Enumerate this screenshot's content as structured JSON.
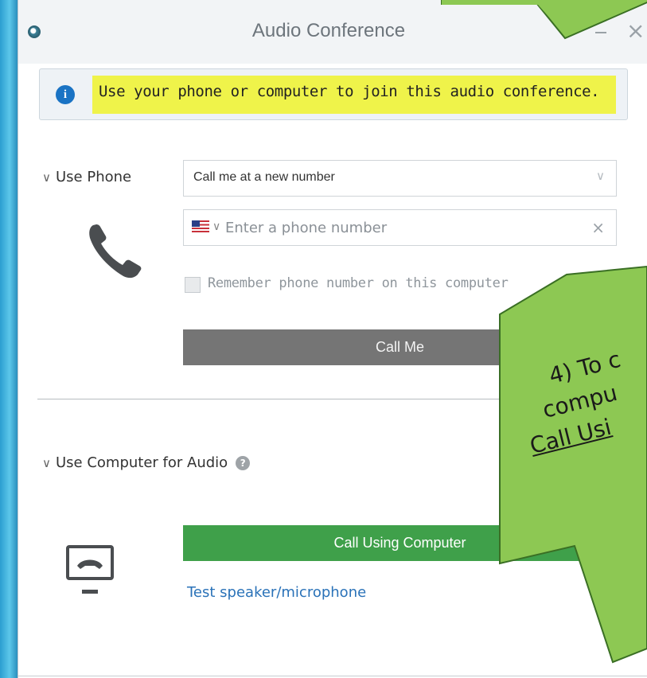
{
  "window": {
    "title": "Audio Conference",
    "close_glyph": "×"
  },
  "info_banner": {
    "icon": "info-icon",
    "icon_glyph": "i",
    "text": "Use your phone or computer to join this audio conference."
  },
  "use_phone": {
    "chevron": "∨",
    "label": "Use Phone",
    "select_value": "Call me at a new number",
    "select_chevron": "∨",
    "phone_placeholder": "Enter a phone number",
    "country_chevron": "∨",
    "clear_glyph": "×",
    "remember_label": "Remember phone number on this computer",
    "call_me_label": "Call Me"
  },
  "use_computer": {
    "chevron": "∨",
    "label": "Use Computer for Audio",
    "help_glyph": "?",
    "call_button_label": "Call Using Computer",
    "test_link": "Test speaker/microphone"
  },
  "callout": {
    "lines": [
      "4) To c",
      "compu",
      "Call Usi"
    ],
    "color": "#8dc853"
  },
  "colors": {
    "highlight": "#eff34a",
    "call_me_bg": "#757575",
    "call_computer_bg": "#3fa04a",
    "link": "#2a72b8"
  }
}
